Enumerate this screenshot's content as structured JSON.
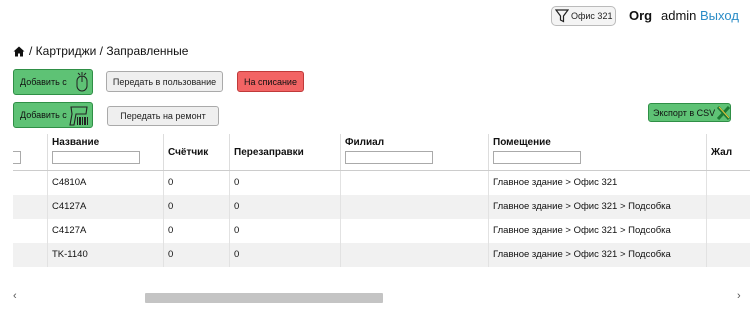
{
  "topbar": {
    "office_label": "Офис 321",
    "org": "Org",
    "user": "admin",
    "logout": "Выход"
  },
  "breadcrumb": {
    "text": "/ Картриджи / Заправленные"
  },
  "buttons": {
    "add_scan": "Добавить с",
    "transfer_user": "Передать в пользование",
    "write_off": "На списание",
    "add_barcode": "Добавить с",
    "transfer_repair": "Передать на ремонт",
    "export_csv": "Экспорт в CSV"
  },
  "colors": {
    "accent_green": "#5ec275",
    "danger_red": "#f26464",
    "link_blue": "#2a8cc7"
  },
  "table": {
    "headers": {
      "name": "Название",
      "counter": "Счётчик",
      "refills": "Перезаправки",
      "branch": "Филиал",
      "room": "Помещение",
      "more": "Жал"
    },
    "rows": [
      {
        "name": "C4810A",
        "counter": "0",
        "refills": "0",
        "branch": "",
        "room": "Главное здание > Офис 321"
      },
      {
        "name": "C4127A",
        "counter": "0",
        "refills": "0",
        "branch": "",
        "room": "Главное здание > Офис 321 > Подсобка"
      },
      {
        "name": "C4127A",
        "counter": "0",
        "refills": "0",
        "branch": "",
        "room": "Главное здание > Офис 321 > Подсобка"
      },
      {
        "name": "TK-1140",
        "counter": "0",
        "refills": "0",
        "branch": "",
        "room": "Главное здание > Офис 321 > Подсобка"
      }
    ]
  }
}
